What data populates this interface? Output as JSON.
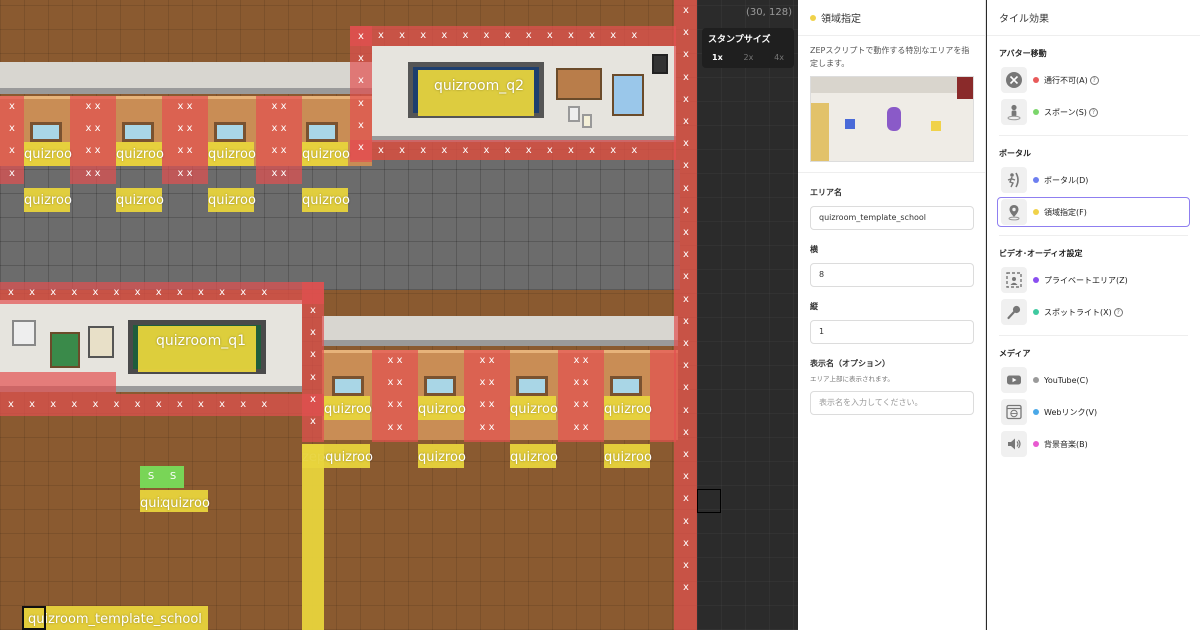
{
  "map": {
    "zones": {
      "quizroom_q2": "quizroom_q2",
      "quizroom_q1": "quizroom_q1",
      "quizroom_short": "quizroo",
      "zepquizroo": "zepquizroo",
      "quiz": "quiz",
      "template_school": "quizroom_template_school",
      "x": "x",
      "spawn": "S"
    }
  },
  "strip": {
    "coords": "(30, 128)",
    "stamp_title": "スタンプサイズ",
    "stamp_options": [
      "1x",
      "2x",
      "4x"
    ]
  },
  "panel": {
    "header": "領域指定",
    "description": "ZEPスクリプトで動作する特別なエリアを指定します。",
    "area_name_label": "エリア名",
    "area_name_value": "quizroom_template_school",
    "width_label": "横",
    "width_value": "8",
    "height_label": "縦",
    "height_value": "1",
    "display_name_label": "表示名（オプション）",
    "display_name_hint": "エリア上部に表示されます。",
    "display_name_placeholder": "表示名を入力してください。"
  },
  "tiles": {
    "header": "タイル効果",
    "groups": [
      {
        "title": "アバター移動",
        "items": [
          {
            "label": "通行不可(A)",
            "color": "#e85a5a",
            "icon": "no-entry-icon",
            "help": true
          },
          {
            "label": "スポーン(S)",
            "color": "#7bd66b",
            "icon": "spawn-person-icon",
            "help": true
          }
        ]
      },
      {
        "title": "ポータル",
        "items": [
          {
            "label": "ポータル(D)",
            "color": "#6d7ff0",
            "icon": "portal-runner-icon"
          },
          {
            "label": "領域指定(F)",
            "color": "#f0d24a",
            "icon": "location-pin-icon",
            "active": true
          }
        ]
      },
      {
        "title": "ビデオ･オーディオ設定",
        "items": [
          {
            "label": "プライベートエリア(Z)",
            "color": "#8a4ff0",
            "icon": "private-area-icon"
          },
          {
            "label": "スポットライト(X)",
            "color": "#3fc9a0",
            "icon": "microphone-icon",
            "help": true
          }
        ]
      },
      {
        "title": "メディア",
        "items": [
          {
            "label": "YouTube(C)",
            "color": "#9a9a9a",
            "icon": "youtube-icon"
          },
          {
            "label": "Webリンク(V)",
            "color": "#4aa8e8",
            "icon": "web-link-icon"
          },
          {
            "label": "背景音楽(B)",
            "color": "#e85ad0",
            "icon": "speaker-icon"
          }
        ]
      }
    ],
    "help_glyph": "?"
  }
}
